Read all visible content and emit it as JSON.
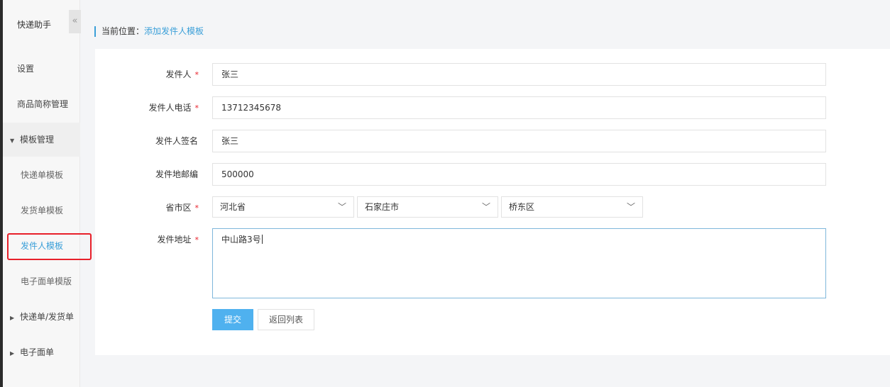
{
  "sidebar": {
    "title": "快递助手",
    "collapse_icon": "«",
    "items": [
      {
        "label": "设置"
      },
      {
        "label": "商品简称管理"
      },
      {
        "label": "模板管理"
      },
      {
        "label": "快递单模板"
      },
      {
        "label": "发货单模板"
      },
      {
        "label": "发件人模板"
      },
      {
        "label": "电子面单模版"
      },
      {
        "label": "快递单/发货单"
      },
      {
        "label": "电子面单"
      }
    ]
  },
  "breadcrumb": {
    "prefix": "当前位置：",
    "current": "添加发件人模板"
  },
  "form": {
    "required_mark": "*",
    "sender_label": "发件人",
    "sender_value": "张三",
    "phone_label": "发件人电话",
    "phone_value": "13712345678",
    "signature_label": "发件人签名",
    "signature_value": "张三",
    "postcode_label": "发件地邮编",
    "postcode_value": "500000",
    "region_label": "省市区",
    "province": "河北省",
    "city": "石家庄市",
    "district": "桥东区",
    "address_label": "发件地址",
    "address_value": "中山路3号",
    "submit_label": "提交",
    "back_label": "返回列表"
  },
  "colors": {
    "accent": "#3a9fd8",
    "primary_button": "#4fb1ef",
    "required": "#e8202a"
  }
}
